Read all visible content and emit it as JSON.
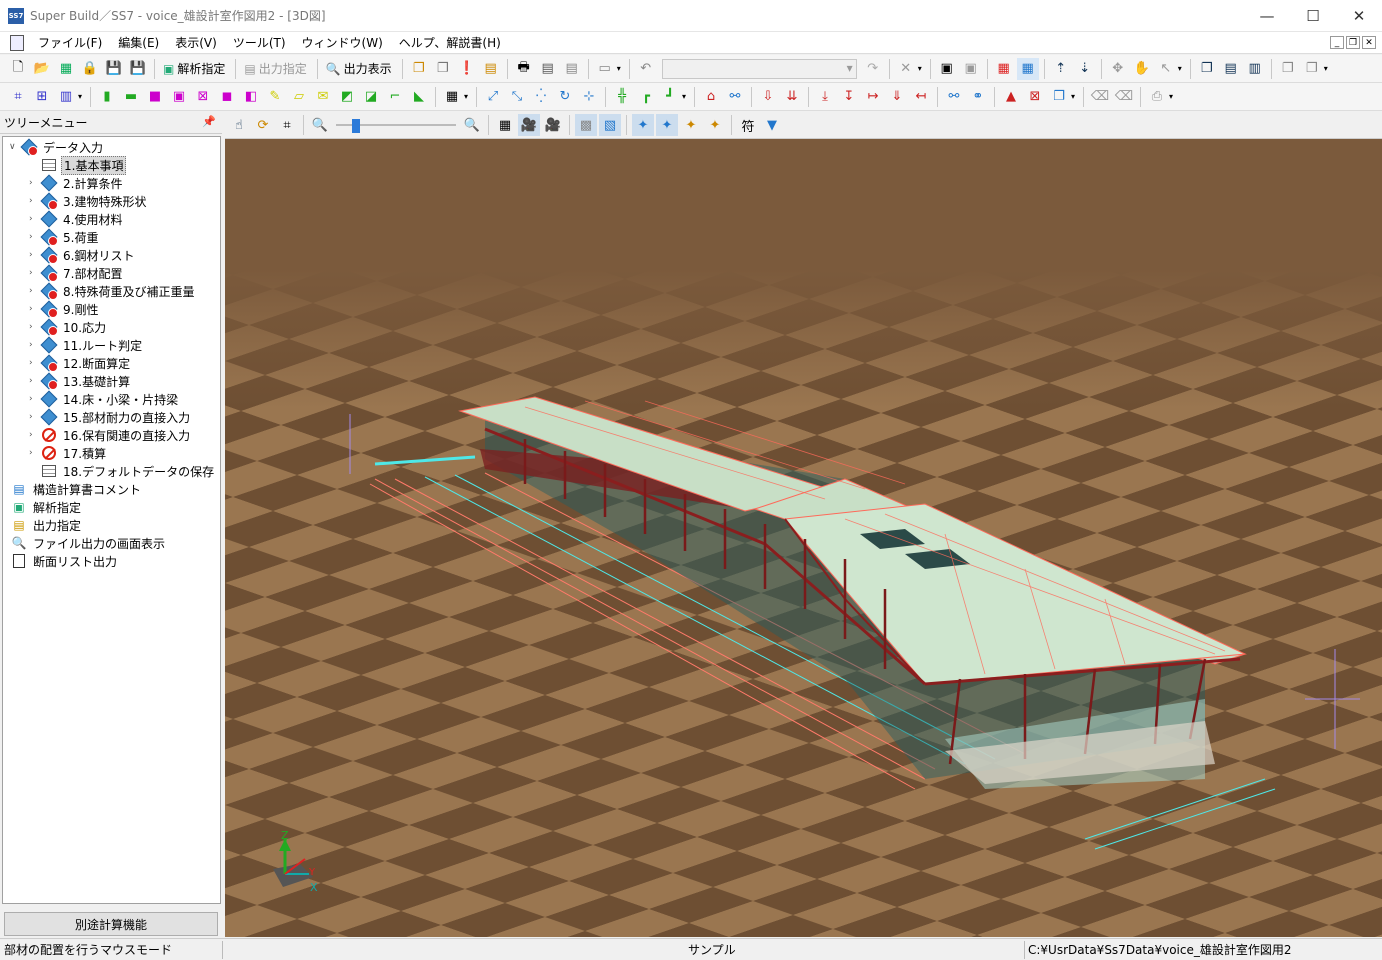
{
  "window": {
    "title": "Super Build／SS7 - voice_雄設計室作図用2 - [3D図]",
    "app_icon": "SS7",
    "minimize_icon": "—",
    "maximize_icon": "☐",
    "close_icon": "✕"
  },
  "menu": {
    "items": [
      "ファイル(F)",
      "編集(E)",
      "表示(V)",
      "ツール(T)",
      "ウィンドウ(W)",
      "ヘルプ、解説書(H)"
    ]
  },
  "toolbar": {
    "analysis_label": "解析指定",
    "output_spec_label": "出力指定",
    "output_view_label": "出力表示",
    "combo_value": ""
  },
  "panel": {
    "title": "ツリーメニュー",
    "pin_icon": "pin-icon"
  },
  "tree": {
    "root": "データ入力",
    "items": [
      "1.基本事項",
      "2.計算条件",
      "3.建物特殊形状",
      "4.使用材料",
      "5.荷重",
      "6.鋼材リスト",
      "7.部材配置",
      "8.特殊荷重及び補正重量",
      "9.剛性",
      "10.応力",
      "11.ルート判定",
      "12.断面算定",
      "13.基礎計算",
      "14.床・小梁・片持梁",
      "15.部材耐力の直接入力",
      "16.保有関連の直接入力",
      "17.積算",
      "18.デフォルトデータの保存"
    ],
    "others": [
      "構造計算書コメント",
      "解析指定",
      "出力指定",
      "ファイル出力の画面表示",
      "断面リスト出力"
    ]
  },
  "bottom_button": "別途計算機能",
  "view": {
    "text_button": "符",
    "axis": {
      "z": "Z",
      "y": "Y",
      "x": "X"
    },
    "colors": {
      "background": "#7b5a3c",
      "floor_light": "#a07d57",
      "floor_dark": "#6e4f33",
      "member_red": "#8a1e1e",
      "glass": "#a8d4c8",
      "grid_red": "#ff6a5a",
      "grid_cyan": "#4ee8e8"
    }
  },
  "status": {
    "mode": "部材の配置を行うマウスモード",
    "center": "サンプル",
    "path": "C:¥UsrData¥Ss7Data¥voice_雄設計室作図用2"
  }
}
